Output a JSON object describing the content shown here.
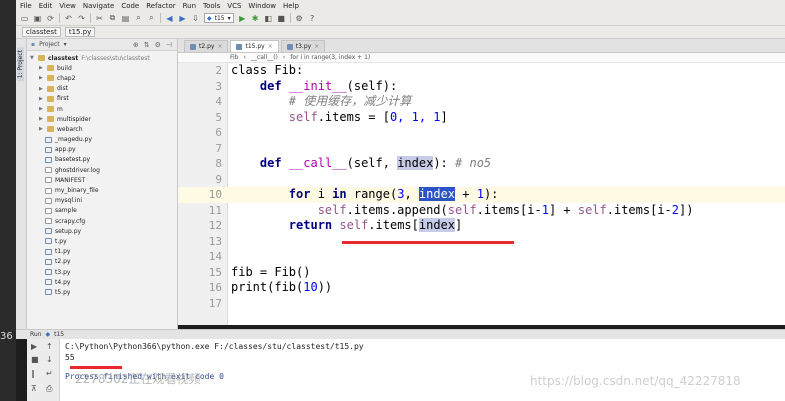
{
  "menu": [
    "File",
    "Edit",
    "View",
    "Navigate",
    "Code",
    "Refactor",
    "Run",
    "Tools",
    "VCS",
    "Window",
    "Help"
  ],
  "toolbar": {
    "run_config": "t15"
  },
  "navbar": {
    "project": "classtest",
    "file": "t15.py"
  },
  "sidebar_tab": "1: Project",
  "project_panel": {
    "header": "Project",
    "root_name": "classtest",
    "root_path": "F:\\classes\\stu\\classtest",
    "items": [
      {
        "name": "build",
        "type": "folder"
      },
      {
        "name": "chap2",
        "type": "folder"
      },
      {
        "name": "dist",
        "type": "folder"
      },
      {
        "name": "first",
        "type": "folder"
      },
      {
        "name": "m",
        "type": "folder"
      },
      {
        "name": "multispider",
        "type": "folder"
      },
      {
        "name": "webarch",
        "type": "folder"
      },
      {
        "name": "_magedu.py",
        "type": "py"
      },
      {
        "name": "app.py",
        "type": "py"
      },
      {
        "name": "basetest.py",
        "type": "py"
      },
      {
        "name": "ghostdriver.log",
        "type": "txt"
      },
      {
        "name": "MANIFEST",
        "type": "txt"
      },
      {
        "name": "my_binary_file",
        "type": "txt"
      },
      {
        "name": "mysql.ini",
        "type": "txt"
      },
      {
        "name": "sample",
        "type": "txt"
      },
      {
        "name": "scrapy.cfg",
        "type": "txt"
      },
      {
        "name": "setup.py",
        "type": "py"
      },
      {
        "name": "t.py",
        "type": "py"
      },
      {
        "name": "t1.py",
        "type": "py"
      },
      {
        "name": "t2.py",
        "type": "py"
      },
      {
        "name": "t3.py",
        "type": "py"
      },
      {
        "name": "t4.py",
        "type": "py"
      },
      {
        "name": "t5.py",
        "type": "py"
      }
    ]
  },
  "tabs": [
    {
      "label": "t2.py",
      "active": false
    },
    {
      "label": "t15.py",
      "active": true
    },
    {
      "label": "t3.py",
      "active": false
    }
  ],
  "editor_breadcrumb": [
    "Fib",
    "__call__()",
    "for i in range(3, index + 1)"
  ],
  "code_lines": [
    2,
    3,
    4,
    5,
    6,
    7,
    8,
    9,
    10,
    11,
    12,
    13,
    14,
    15,
    16,
    17
  ],
  "code": {
    "l2": "class Fib:",
    "l3_kw": "def",
    "l3_name": "__init__",
    "l3_rest": "(self):",
    "l4": "# 使用缓存，减少计算",
    "l5_self": "self",
    "l5_rest": ".items = [",
    "l5_nums": "0, 1, 1",
    "l5_end": "]",
    "l7_kw": "def",
    "l7_name": "__call__",
    "l7_a": "(self, ",
    "l7_idx": "index",
    "l7_b": "): ",
    "l7_com": "# no5",
    "l10_kw1": "for",
    "l10_a": " i ",
    "l10_kw2": "in",
    "l10_b": " range(",
    "l10_n1": "3",
    "l10_c": ", ",
    "l10_idx": "index",
    "l10_d": " + ",
    "l10_n2": "1",
    "l10_e": "):",
    "l11_s1": "self",
    "l11_a": ".items.append(",
    "l11_s2": "self",
    "l11_b": ".items[i-",
    "l11_n1": "1",
    "l11_c": "] + ",
    "l11_s3": "self",
    "l11_d": ".items[i-",
    "l11_n2": "2",
    "l11_e": "])",
    "l12_kw": "return",
    "l12_s": "self",
    "l12_a": ".items[",
    "l12_idx": "index",
    "l12_b": "]",
    "l15": "fib = Fib()",
    "l16_a": "print(fib(",
    "l16_n": "10",
    "l16_b": "))"
  },
  "run_panel": {
    "label": "Run",
    "config": "t15",
    "command": "C:\\Python\\Python366\\python.exe F:/classes/stu/classtest/t15.py",
    "output": "55",
    "finished": "Process finished with exit code 0"
  },
  "watermark": "https://blog.csdn.net/qq_42227818",
  "overlay_text": "2278302正在观看视频",
  "left_edge_number": "36",
  "colors": {
    "highlight_line": "#fffae3",
    "keyword": "#000080",
    "selection": "#2b53c7",
    "red_mark": "#e8282c"
  }
}
